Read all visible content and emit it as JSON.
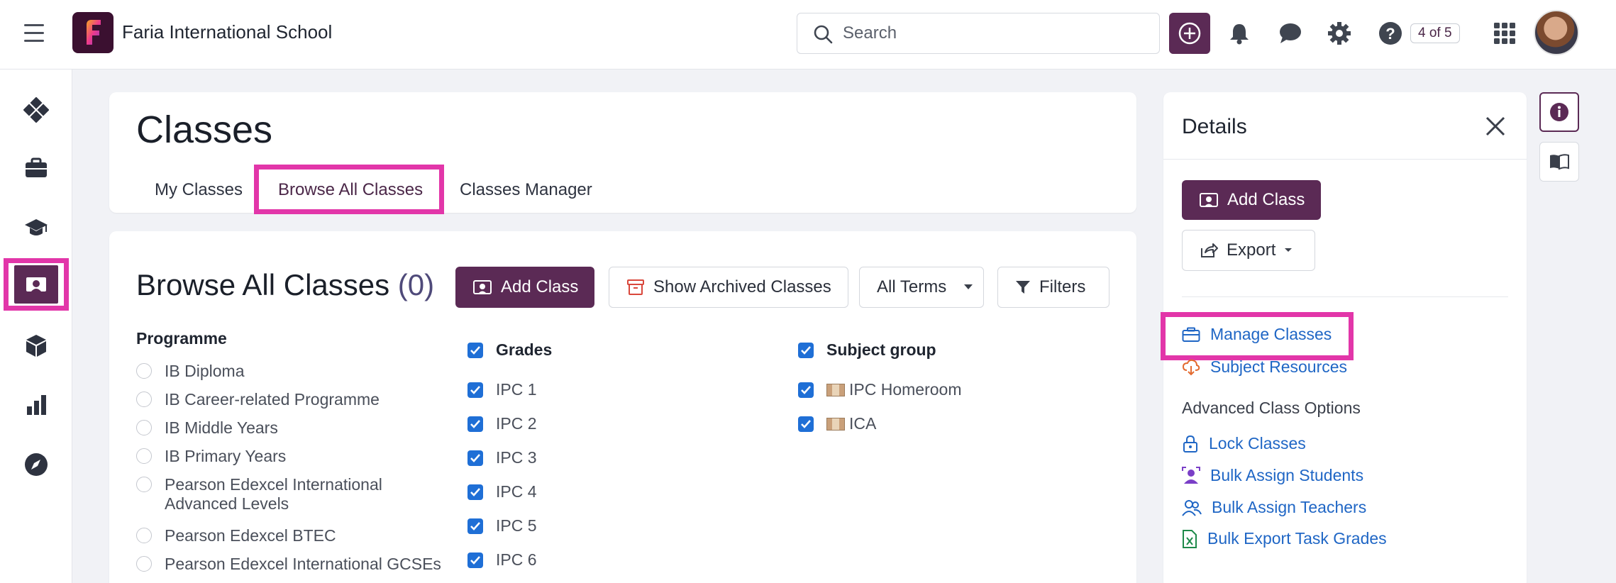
{
  "topbar": {
    "school_name": "Faria International School",
    "search_placeholder": "Search",
    "pager": "4 of 5"
  },
  "header": {
    "title": "Classes",
    "tabs": [
      {
        "label": "My Classes"
      },
      {
        "label": "Browse All Classes",
        "selected": true
      },
      {
        "label": "Classes Manager"
      }
    ]
  },
  "browse": {
    "title": "Browse All Classes",
    "count": "(0)",
    "add_class": "Add Class",
    "show_archived": "Show Archived Classes",
    "terms": "All Terms",
    "filters": "Filters"
  },
  "programme": {
    "label": "Programme",
    "options": [
      "IB Diploma",
      "IB Career-related Programme",
      "IB Middle Years",
      "IB Primary Years",
      "Pearson Edexcel International",
      "Advanced Levels",
      "Pearson Edexcel BTEC",
      "Pearson Edexcel International GCSEs"
    ]
  },
  "grades": {
    "label": "Grades",
    "items": [
      "IPC 1",
      "IPC 2",
      "IPC 3",
      "IPC 4",
      "IPC 5",
      "IPC 6"
    ]
  },
  "subject_group": {
    "label": "Subject group",
    "items": [
      "IPC Homeroom",
      "ICA"
    ]
  },
  "details": {
    "title": "Details",
    "add_class": "Add Class",
    "export": "Export",
    "manage_classes": "Manage Classes",
    "subject_resources": "Subject Resources",
    "advanced_label": "Advanced Class Options",
    "lock_classes": "Lock Classes",
    "bulk_assign_students": "Bulk Assign Students",
    "bulk_assign_teachers": "Bulk Assign Teachers",
    "bulk_export_task_grades": "Bulk Export Task Grades"
  },
  "colors": {
    "brand": "#5b2a55",
    "highlight": "#e236a9",
    "link": "#1f66c5",
    "checkbox": "#1f6fd6"
  }
}
